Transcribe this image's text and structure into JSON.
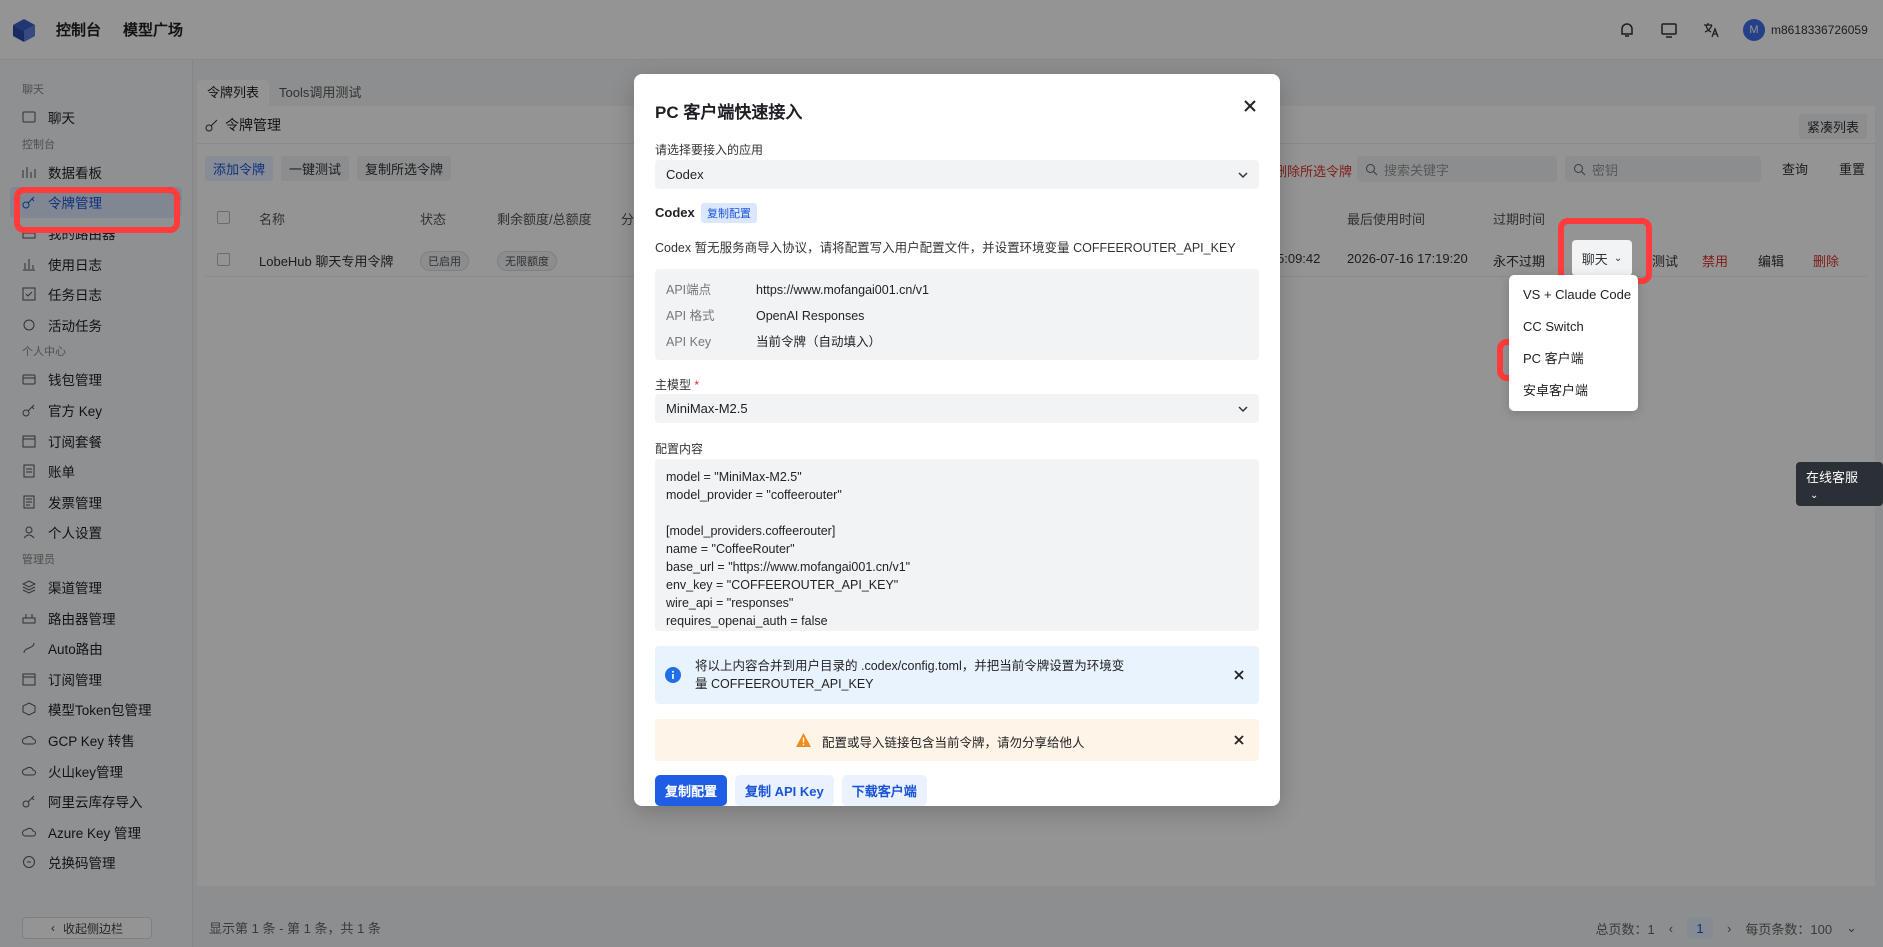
{
  "header": {
    "nav": [
      "控制台",
      "模型广场"
    ],
    "avatar_letter": "M",
    "user_name": "m8618336726059"
  },
  "sidebar": {
    "groups": [
      {
        "title": "聊天",
        "items": [
          {
            "label": "聊天",
            "icon": "chat-icon"
          }
        ]
      },
      {
        "title": "控制台",
        "items": [
          {
            "label": "数据看板",
            "icon": "dashboard-icon"
          },
          {
            "label": "令牌管理",
            "icon": "key-icon",
            "active": true
          },
          {
            "label": "我的路由器",
            "icon": "router-icon"
          },
          {
            "label": "使用日志",
            "icon": "bar-chart-icon"
          },
          {
            "label": "任务日志",
            "icon": "task-icon"
          },
          {
            "label": "活动任务",
            "icon": "refresh-icon"
          }
        ]
      },
      {
        "title": "个人中心",
        "items": [
          {
            "label": "钱包管理",
            "icon": "wallet-icon"
          },
          {
            "label": "官方 Key",
            "icon": "key-icon"
          },
          {
            "label": "订阅套餐",
            "icon": "calendar-icon"
          },
          {
            "label": "账单",
            "icon": "bill-icon"
          },
          {
            "label": "发票管理",
            "icon": "invoice-icon"
          },
          {
            "label": "个人设置",
            "icon": "user-icon"
          }
        ]
      },
      {
        "title": "管理员",
        "items": [
          {
            "label": "渠道管理",
            "icon": "layers-icon"
          },
          {
            "label": "路由器管理",
            "icon": "router-icon"
          },
          {
            "label": "Auto路由",
            "icon": "route-icon"
          },
          {
            "label": "订阅管理",
            "icon": "calendar-icon"
          },
          {
            "label": "模型Token包管理",
            "icon": "box-icon"
          },
          {
            "label": "GCP Key 转售",
            "icon": "cloud-icon"
          },
          {
            "label": "火山key管理",
            "icon": "cloud-icon"
          },
          {
            "label": "阿里云库存导入",
            "icon": "key-icon"
          },
          {
            "label": "Azure Key 管理",
            "icon": "cloud-icon"
          },
          {
            "label": "兑换码管理",
            "icon": "ticket-icon"
          }
        ]
      }
    ],
    "collapse_label": "收起侧边栏"
  },
  "main": {
    "tabs": [
      "令牌列表",
      "Tools调用测试"
    ],
    "panel_title": "令牌管理",
    "compact_label": "紧凑列表",
    "toolbar": [
      "添加令牌",
      "一键测试",
      "复制所选令牌"
    ],
    "delete_selected": "删除所选令牌",
    "search_keyword_placeholder": "搜索关键字",
    "search_key_placeholder": "密钥",
    "query_label": "查询",
    "reset_label": "重置",
    "columns": [
      "名称",
      "状态",
      "剩余额度/总额度",
      "分",
      "最后使用时间",
      "过期时间"
    ],
    "row": {
      "name": "LobeHub 聊天专用令牌",
      "status": "已启用",
      "quota": "无限额度",
      "created_partial": "5:09:42",
      "last_used": "2026-07-16 17:19:20",
      "expire": "永不过期",
      "actions": [
        "聊天",
        "测试",
        "禁用",
        "编辑",
        "删除"
      ]
    },
    "footer": "显示第 1 条 - 第 1 条，共 1 条",
    "pager": {
      "total_label": "总页数：1",
      "current": "1",
      "page_size": "每页条数：100"
    }
  },
  "dropdown": [
    "VS + Claude Code",
    "CC Switch",
    "PC 客户端",
    "安卓客户端"
  ],
  "online_service": "在线客服",
  "modal": {
    "title": "PC 客户端快速接入",
    "app_label": "请选择要接入的应用",
    "app_value": "Codex",
    "section_name": "Codex",
    "copy_config_tag": "复制配置",
    "description": "Codex 暂无服务商导入协议，请将配置写入用户配置文件，并设置环境变量 COFFEEROUTER_API_KEY",
    "info": [
      {
        "key": "API端点",
        "value": "https://www.mofangai001.cn/v1"
      },
      {
        "key": "API 格式",
        "value": "OpenAI Responses"
      },
      {
        "key": "API Key",
        "value": "当前令牌（自动填入）"
      }
    ],
    "main_model_label": "主模型",
    "required_mark": "*",
    "main_model_value": "MiniMax-M2.5",
    "config_label": "配置内容",
    "config_content": "model = \"MiniMax-M2.5\"\nmodel_provider = \"coffeerouter\"\n\n[model_providers.coffeerouter]\nname = \"CoffeeRouter\"\nbase_url = \"https://www.mofangai001.cn/v1\"\nenv_key = \"COFFEEROUTER_API_KEY\"\nwire_api = \"responses\"\nrequires_openai_auth = false",
    "info_alert": "将以上内容合并到用户目录的 .codex/config.toml，并把当前令牌设置为环境变量 COFFEEROUTER_API_KEY",
    "warn_alert": "配置或导入链接包含当前令牌，请勿分享给他人",
    "buttons": [
      "复制配置",
      "复制 API Key",
      "下载客户端"
    ]
  },
  "colors": {
    "accent": "#1f5de5",
    "highlight": "#ff3b3b",
    "danger": "#d9342b",
    "overlay": "rgba(0,0,0,0.42)"
  }
}
